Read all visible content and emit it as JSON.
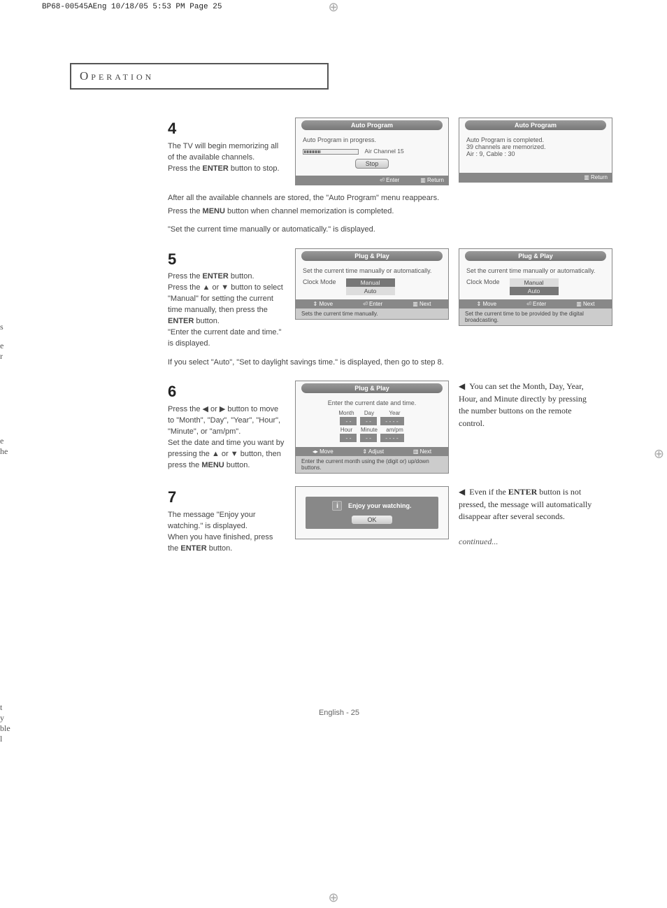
{
  "print_header": "BP68-00545AEng  10/18/05  5:53 PM  Page 25",
  "section_title": "Operation",
  "left_frag_1": "s",
  "left_frag_2a": "e",
  "left_frag_2b": "r",
  "left_frag_3a": "e",
  "left_frag_3b": "he",
  "left_frag_4a": "t",
  "left_frag_4b": "y",
  "left_frag_4c": "ble",
  "left_frag_4d": "l",
  "step4": {
    "num": "4",
    "text_a": "The TV will begin memorizing all of the available channels.",
    "text_b": "Press the ",
    "text_b_bold": "ENTER",
    "text_b_after": " button to stop.",
    "osd1_title": "Auto Program",
    "osd1_line1": "Auto Program in progress.",
    "osd1_channel": "Air Channel 15",
    "osd1_stop": "Stop",
    "osd1_enter": "Enter",
    "osd1_return": "Return",
    "osd2_title": "Auto Program",
    "osd2_line1": "Auto Program is completed.",
    "osd2_line2": "39 channels are memorized.",
    "osd2_line3": "Air : 9, Cable : 30",
    "osd2_return": "Return",
    "under1": "After all the available  channels are stored, the \"Auto Program\" menu  reappears.",
    "under2_a": "Press the ",
    "under2_bold": "MENU",
    "under2_b": " button when channel memorization is completed.",
    "under3": "\"Set the current time manually or automatically.\" is displayed."
  },
  "step5": {
    "num": "5",
    "text_a1": "Press the ",
    "text_a1_bold": "ENTER",
    "text_a1_after": " button.",
    "text_b": "Press the ▲ or ▼ button to select \"Manual\" for setting the current time manually, then press the ",
    "text_b_bold": "ENTER",
    "text_b_after": " button.",
    "text_c": "\"Enter the current date and time.\" is displayed.",
    "osd1_title": "Plug & Play",
    "osd1_line1": "Set the current time manually or automatically.",
    "osd1_label": "Clock Mode",
    "osd1_opt1": "Manual",
    "osd1_opt2": "Auto",
    "osd1_move": "Move",
    "osd1_enter": "Enter",
    "osd1_next": "Next",
    "osd1_help": "Sets the current time manually.",
    "osd2_title": "Plug & Play",
    "osd2_line1": "Set the current time manually or automatically.",
    "osd2_label": "Clock Mode",
    "osd2_opt1": "Manual",
    "osd2_opt2": "Auto",
    "osd2_move": "Move",
    "osd2_enter": "Enter",
    "osd2_next": "Next",
    "osd2_help": "Set the current time to be provided by the digital broadcasting.",
    "under": "If you select \"Auto\", \"Set to daylight savings time.\" is displayed, then go to step 8."
  },
  "step6": {
    "num": "6",
    "text_a": "Press the ◀ or ▶ button to move to \"Month\", \"Day\", \"Year\", \"Hour\", \"Minute\",  or \"am/pm\".",
    "text_b": "Set the date and time you want by pressing the ▲ or ▼ button, then press the ",
    "text_b_bold": "MENU",
    "text_b_after": " button.",
    "osd_title": "Plug & Play",
    "osd_line1": "Enter the current date and time.",
    "lbl_month": "Month",
    "lbl_day": "Day",
    "lbl_year": "Year",
    "lbl_hour": "Hour",
    "lbl_minute": "Minute",
    "lbl_ampm": "am/pm",
    "val_dash2": "- -",
    "val_dash4": "- - - -",
    "osd_move": "Move",
    "osd_adjust": "Adjust",
    "osd_next": "Next",
    "osd_help": "Enter the current month using the (digit or) up/down buttons.",
    "side_note": "You can set the Month, Day, Year,  Hour, and Minute directly by pressing the number buttons on the remote control."
  },
  "step7": {
    "num": "7",
    "text_a": "The message \"Enjoy your watching.\" is displayed.",
    "text_b": "When you have finished, press the ",
    "text_b_bold": "ENTER",
    "text_b_after": " button.",
    "osd_msg": "Enjoy your watching.",
    "osd_ok": "OK",
    "side_note_a": "Even if the ",
    "side_note_bold": "ENTER",
    "side_note_b": " button is not pressed, the message will automatically disappear after several seconds.",
    "continued": "continued..."
  },
  "footer": "English - 25"
}
